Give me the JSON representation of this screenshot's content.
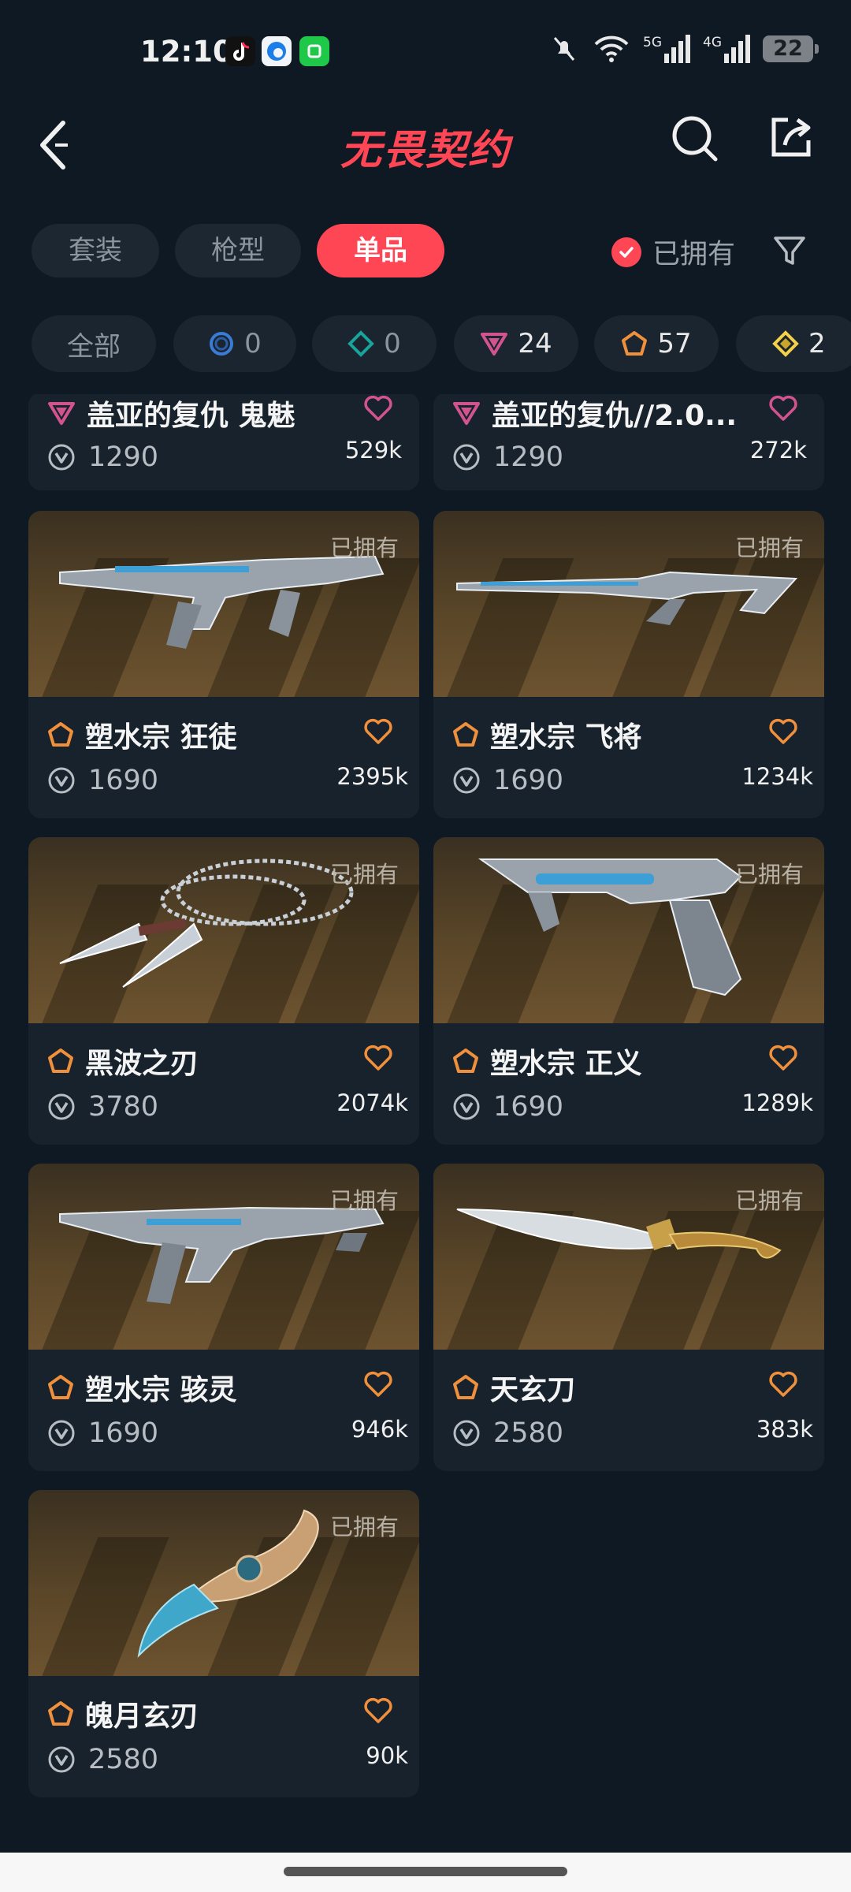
{
  "status_bar": {
    "time": "12:10",
    "network_1": "5G",
    "network_2": "4G",
    "battery": "22"
  },
  "header": {
    "title": "无畏契约"
  },
  "category_tabs": [
    {
      "label": "套装",
      "active": false
    },
    {
      "label": "枪型",
      "active": false
    },
    {
      "label": "单品",
      "active": true
    }
  ],
  "owned_filter": {
    "label": "已拥有",
    "checked": true
  },
  "tier_filters": [
    {
      "label": "全部",
      "icon": "none"
    },
    {
      "count": "0",
      "icon": "select-tier-icon",
      "color": "#3a7bd5"
    },
    {
      "count": "0",
      "icon": "deluxe-tier-icon",
      "color": "#1aa39a"
    },
    {
      "count": "24",
      "icon": "premium-tier-icon",
      "color": "#d2548e"
    },
    {
      "count": "57",
      "icon": "exclusive-tier-icon",
      "color": "#f0903c"
    },
    {
      "count": "2",
      "icon": "ultra-tier-icon",
      "color": "#f5d14a"
    }
  ],
  "items": [
    {
      "name": "盖亚的复仇 鬼魅",
      "tier": "premium",
      "price": "1290",
      "likes": "529k",
      "owned": false
    },
    {
      "name": "盖亚的复仇//2.0...",
      "tier": "premium",
      "price": "1290",
      "likes": "272k",
      "owned": false
    },
    {
      "name": "塑水宗 狂徒",
      "tier": "exclusive",
      "price": "1690",
      "likes": "2395k",
      "owned": true,
      "owned_label": "已拥有"
    },
    {
      "name": "塑水宗 飞将",
      "tier": "exclusive",
      "price": "1690",
      "likes": "1234k",
      "owned": true,
      "owned_label": "已拥有"
    },
    {
      "name": "黑波之刃",
      "tier": "exclusive",
      "price": "3780",
      "likes": "2074k",
      "owned": true,
      "owned_label": "已拥有"
    },
    {
      "name": "塑水宗 正义",
      "tier": "exclusive",
      "price": "1690",
      "likes": "1289k",
      "owned": true,
      "owned_label": "已拥有"
    },
    {
      "name": "塑水宗 骇灵",
      "tier": "exclusive",
      "price": "1690",
      "likes": "946k",
      "owned": true,
      "owned_label": "已拥有"
    },
    {
      "name": "天玄刀",
      "tier": "exclusive",
      "price": "2580",
      "likes": "383k",
      "owned": true,
      "owned_label": "已拥有"
    },
    {
      "name": "魄月玄刃",
      "tier": "exclusive",
      "price": "2580",
      "likes": "90k",
      "owned": true,
      "owned_label": "已拥有"
    }
  ],
  "colors": {
    "accent": "#ff4655",
    "background": "#0f1923",
    "card": "#17222c",
    "premium": "#d2548e",
    "exclusive": "#f0903c"
  }
}
